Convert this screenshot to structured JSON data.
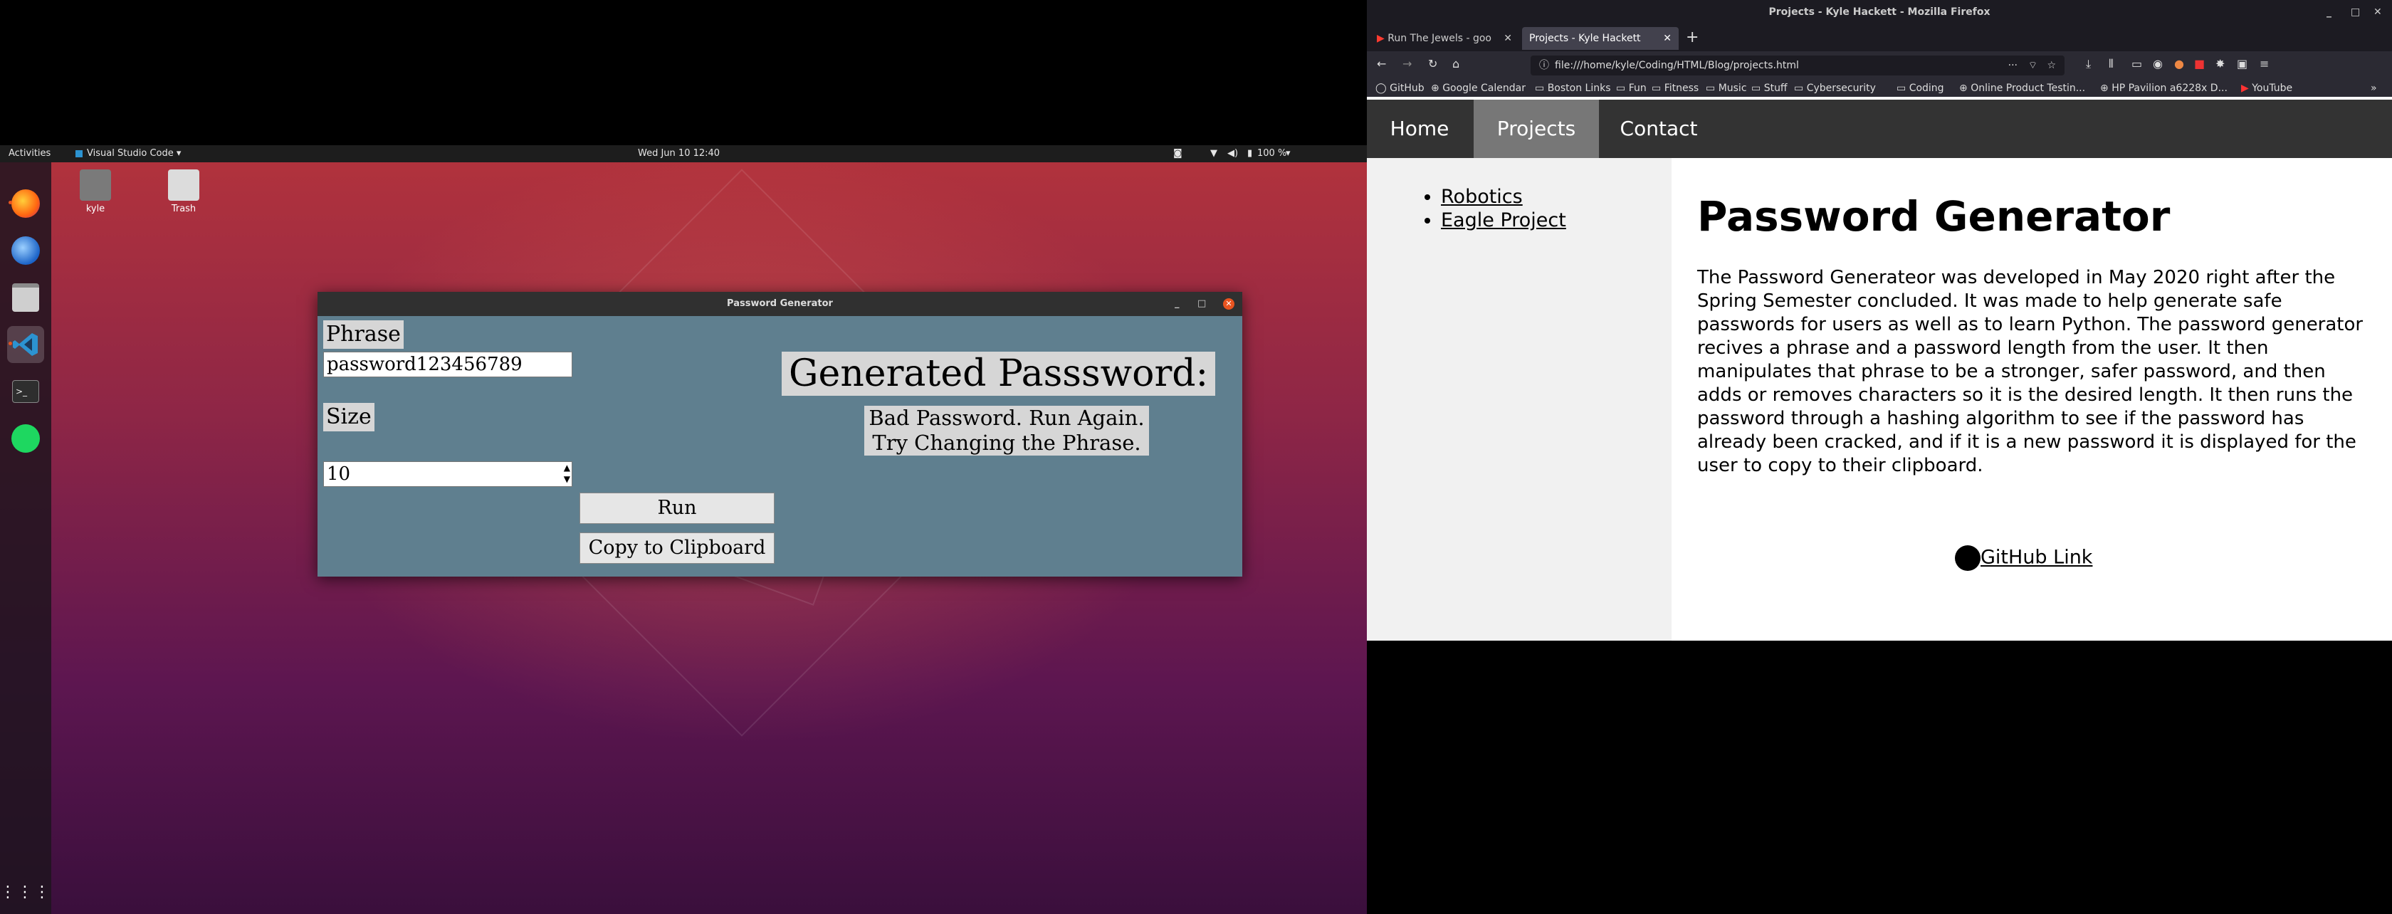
{
  "ubuntu": {
    "activities": "Activities",
    "app_menu": "Visual Studio Code ▾",
    "clock": "Wed Jun 10  12:40",
    "battery": "100 %",
    "desktop_icons": [
      {
        "label": "kyle"
      },
      {
        "label": "Trash"
      }
    ]
  },
  "password_window": {
    "title": "Password Generator",
    "phrase_label": "Phrase",
    "phrase_value": "password123456789",
    "size_label": "Size",
    "size_value": "10",
    "run_label": "Run",
    "copy_label": "Copy to Clipboard",
    "generated_label": "Generated Passsword:",
    "result_line1": "Bad Password. Run Again.",
    "result_line2": "Try Changing the Phrase."
  },
  "firefox": {
    "window_title": "Projects - Kyle Hackett - Mozilla Firefox",
    "tabs": [
      {
        "label": "Run The Jewels - goo"
      },
      {
        "label": "Projects - Kyle Hackett"
      }
    ],
    "url": "file:///home/kyle/Coding/HTML/Blog/projects.html",
    "bookmarks": [
      "GitHub",
      "Google Calendar",
      "Boston Links",
      "Fun",
      "Fitness",
      "Music",
      "Stuff",
      "Cybersecurity",
      "Coding",
      "Online Product Testin...",
      "HP Pavilion a6228x D...",
      "YouTube"
    ],
    "page": {
      "nav": [
        "Home",
        "Projects",
        "Contact"
      ],
      "sidebar_links": [
        "Robotics",
        "Eagle Project"
      ],
      "heading": "Password Generator",
      "body": "The Password Generateor was developed in May 2020 right after the Spring Semester concluded. It was made to help generate safe passwords for users as well as to learn Python. The password generator recives a phrase and a password length from the user. It then manipulates that phrase to be a stronger, safer password, and then adds or removes characters so it is the desired length. It then runs the password through a hashing algorithm to see if the password has already been cracked, and if it is a new password it is displayed for the user to copy to their clipboard.",
      "github_link": "GitHub Link"
    }
  }
}
